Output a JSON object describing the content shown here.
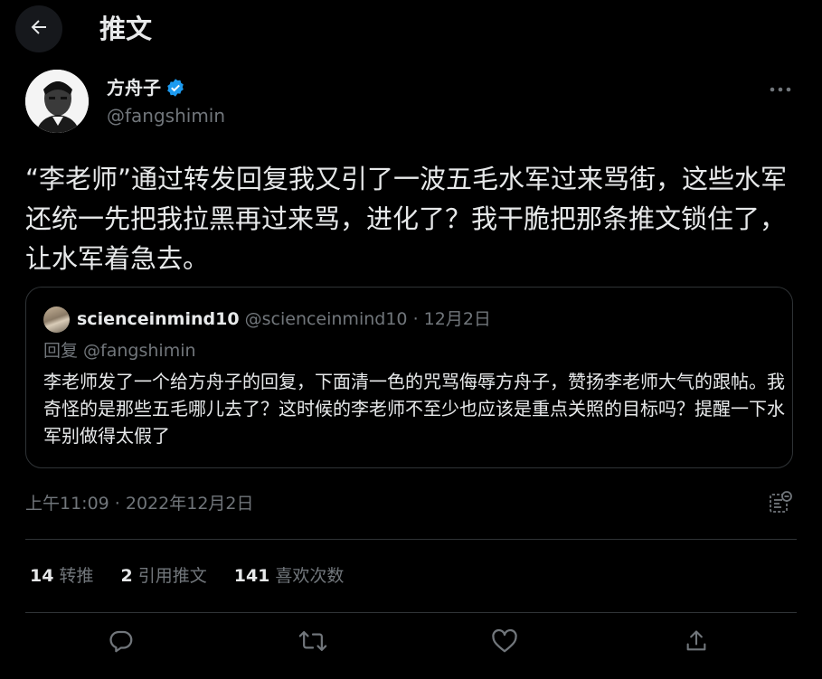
{
  "header": {
    "back_icon": "arrow-left-icon",
    "title": "推文"
  },
  "author": {
    "name": "方舟子",
    "verified": true,
    "verified_color": "#1d9bf0",
    "handle": "@fangshimin"
  },
  "tweet": {
    "text": "“李老师”通过转发回复我又引了一波五毛水军过来骂街，这些水军还统一先把我拉黑再过来骂，进化了？我干脆把那条推文锁住了，让水军着急去。"
  },
  "quote": {
    "name": "scienceinmind10",
    "handle": "@scienceinmind10",
    "separator": "·",
    "date": "12月2日",
    "reply_to": "回复 @fangshimin",
    "text": "李老师发了一个给方舟子的回复，下面清一色的咒骂侮辱方舟子，赞扬李老师大气的跟帖。我奇怪的是那些五毛哪儿去了？这时候的李老师不至少也应该是重点关照的目标吗？提醒一下水军别做得太假了"
  },
  "timestamp": "上午11:09 · 2022年12月2日",
  "stats": {
    "retweets_count": "14",
    "retweets_label": "转推",
    "quotes_count": "2",
    "quotes_label": "引用推文",
    "likes_count": "141",
    "likes_label": "喜欢次数"
  },
  "actions": [
    "reply-icon",
    "retweet-icon",
    "like-icon",
    "share-icon"
  ],
  "colors": {
    "background": "#000000",
    "text_primary": "#e7e9ea",
    "text_secondary": "#71767b",
    "border": "#2f3336"
  }
}
